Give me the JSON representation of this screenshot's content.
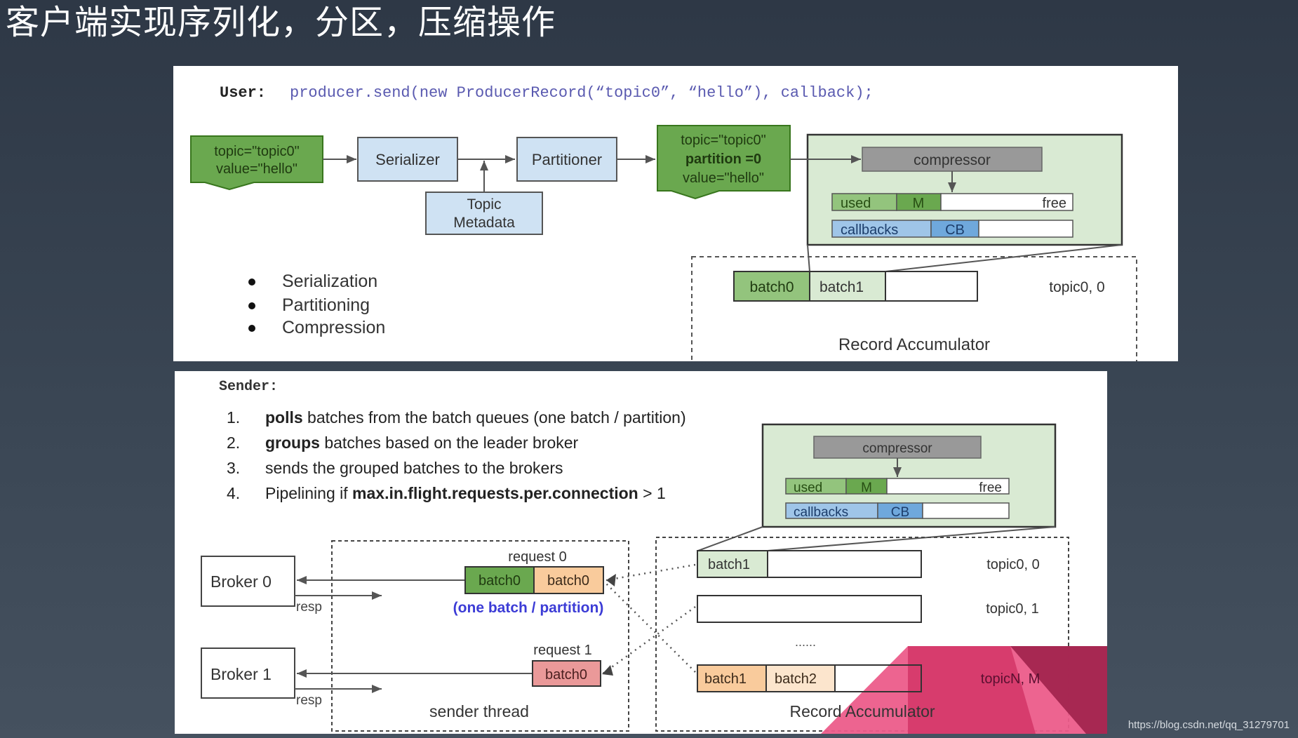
{
  "title": "客户端实现序列化，分区，压缩操作",
  "watermark": "https://blog.csdn.net/qq_31279701",
  "colors": {
    "record_green": "#6aa84f",
    "light_blue": "#cfe2f3",
    "light_green_bg": "#d9ead3",
    "compressor_gray": "#999999",
    "used_green": "#93c47d",
    "m_green": "#6aa84f",
    "callbacks_blue": "#9fc5e8",
    "cb_blue": "#6fa8dc",
    "batch0_orange": "#f9cb9c",
    "batch_red": "#ea9999",
    "batch2_peach": "#fce5cd",
    "note_blue": "#3c3cd6",
    "accent_pink": "#e23e74"
  },
  "top": {
    "code_label": "User:",
    "code": "producer.send(new ProducerRecord(“topic0”, “hello”), callback);",
    "record_in": [
      "topic=\"topic0\"",
      "value=\"hello\""
    ],
    "serializer": "Serializer",
    "partitioner": "Partitioner",
    "topic_metadata": [
      "Topic",
      "Metadata"
    ],
    "record_out": [
      "topic=\"topic0\"",
      "partition =0",
      "value=\"hello\""
    ],
    "compressor": "compressor",
    "used": "used",
    "m": "M",
    "free": "free",
    "callbacks": "callbacks",
    "cb": "CB",
    "batch0": "batch0",
    "batch1": "batch1",
    "partition_label": "topic0, 0",
    "accumulator": "Record Accumulator",
    "bullets": [
      "Serialization",
      "Partitioning",
      "Compression"
    ]
  },
  "bottom": {
    "code_label": "Sender:",
    "steps": [
      {
        "num": "1.",
        "bold": "polls",
        "text": " batches from the batch queues (one batch / partition)",
        "bold_tail": "",
        "tail": ""
      },
      {
        "num": "2.",
        "bold": "groups",
        "text": " batches based on the leader broker",
        "bold_tail": "",
        "tail": ""
      },
      {
        "num": "3.",
        "bold": "",
        "text": "sends the grouped batches to the brokers",
        "bold_tail": "",
        "tail": ""
      },
      {
        "num": "4.",
        "bold": "",
        "text": "Pipelining if ",
        "bold_tail": "max.in.flight.requests.per.connection",
        "tail": " > 1"
      }
    ],
    "compressor": "compressor",
    "used": "used",
    "m": "M",
    "free": "free",
    "callbacks": "callbacks",
    "cb": "CB",
    "broker0": "Broker 0",
    "broker1": "Broker 1",
    "resp": "resp",
    "request0": "request 0",
    "request1": "request 1",
    "batch0": "batch0",
    "batch1": "batch1",
    "batch2": "batch2",
    "one_batch_note": "(one batch / partition)",
    "sender_thread": "sender thread",
    "partitions": [
      "topic0, 0",
      "topic0, 1",
      "topicN, M"
    ],
    "ellipsis": "......",
    "accumulator": "Record Accumulator"
  }
}
